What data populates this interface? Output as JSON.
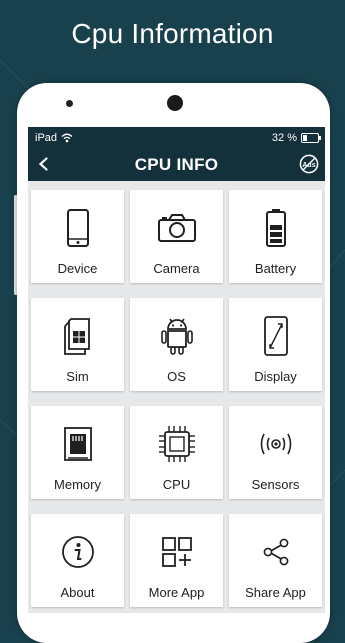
{
  "headline": "Cpu Information",
  "status_bar": {
    "carrier": "iPad",
    "battery_percent": "32 %"
  },
  "app_bar": {
    "title": "CPU INFO",
    "back_icon": "back-arrow-icon",
    "ad_icon": "ad-free-icon"
  },
  "tiles": [
    {
      "label": "Device",
      "icon": "smartphone-icon"
    },
    {
      "label": "Camera",
      "icon": "camera-icon"
    },
    {
      "label": "Battery",
      "icon": "battery-icon"
    },
    {
      "label": "Sim",
      "icon": "sim-card-icon"
    },
    {
      "label": "OS",
      "icon": "android-icon"
    },
    {
      "label": "Display",
      "icon": "display-icon"
    },
    {
      "label": "Memory",
      "icon": "memory-card-icon"
    },
    {
      "label": "CPU",
      "icon": "cpu-chip-icon"
    },
    {
      "label": "Sensors",
      "icon": "sensors-icon"
    },
    {
      "label": "About",
      "icon": "info-icon"
    },
    {
      "label": "More App",
      "icon": "apps-grid-icon"
    },
    {
      "label": "Share App",
      "icon": "share-icon"
    }
  ],
  "colors": {
    "background": "#18414d",
    "bar": "#14303b",
    "tile": "#ffffff",
    "screen": "#e6e8e9"
  }
}
